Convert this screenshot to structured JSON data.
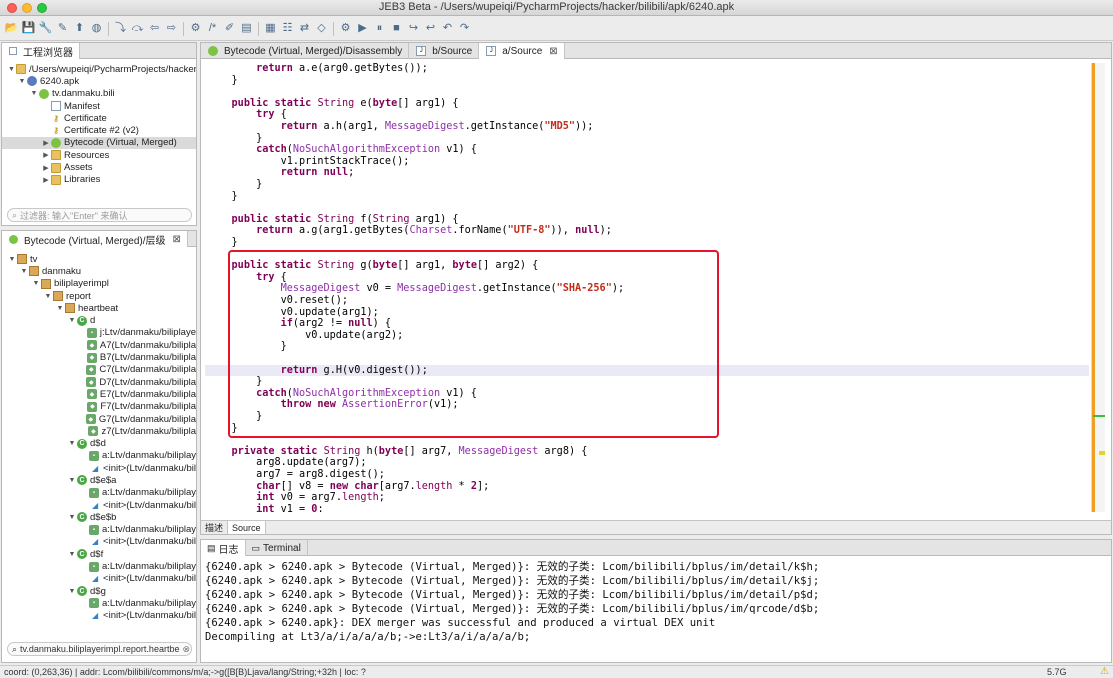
{
  "window": {
    "title": "JEB3 Beta - /Users/wupeiqi/PycharmProjects/hacker/bilibili/apk/6240.apk"
  },
  "toolbar": {
    "icons": [
      "open-folder-icon",
      "save-icon",
      "wrench-icon",
      "script-icon",
      "upload-icon",
      "globe-icon",
      "step-in-icon",
      "step-over-icon",
      "back-icon",
      "forward-icon",
      "run-script-icon",
      "comment-icon",
      "rename-icon",
      "doc-icon",
      "grid-icon",
      "hierarchy-icon",
      "xref-icon",
      "graph-icon",
      "debug-gear-icon",
      "play-icon",
      "pause-icon",
      "stop-icon",
      "step-icon",
      "step-out-icon",
      "step-back-icon",
      "step-into-icon"
    ]
  },
  "project_explorer": {
    "tab": "工程浏览器",
    "filter_placeholder": "过滤器: 输入\"Enter\" 来确认",
    "items": [
      {
        "label": "/Users/wupeiqi/PycharmProjects/hacker/b",
        "icon": "folder-icon"
      },
      {
        "label": "6240.apk",
        "icon": "apk-icon"
      },
      {
        "label": "tv.danmaku.bili",
        "icon": "android-icon"
      },
      {
        "label": "Manifest",
        "icon": "file-icon"
      },
      {
        "label": "Certificate",
        "icon": "key-icon"
      },
      {
        "label": "Certificate #2 (v2)",
        "icon": "key-icon"
      },
      {
        "label": "Bytecode (Virtual, Merged)",
        "icon": "android-icon"
      },
      {
        "label": "Resources",
        "icon": "folder-icon"
      },
      {
        "label": "Assets",
        "icon": "folder-icon"
      },
      {
        "label": "Libraries",
        "icon": "folder-icon"
      }
    ]
  },
  "hierarchy": {
    "tab": "Bytecode (Virtual, Merged)/层级",
    "filter_value": "tv.danmaku.biliplayerimpl.report.heartbe",
    "items": [
      {
        "label": "tv",
        "icon": "package-icon"
      },
      {
        "label": "danmaku",
        "icon": "package-icon"
      },
      {
        "label": "biliplayerimpl",
        "icon": "package-icon"
      },
      {
        "label": "report",
        "icon": "package-icon"
      },
      {
        "label": "heartbeat",
        "icon": "package-icon"
      },
      {
        "label": "d",
        "icon": "class-icon"
      },
      {
        "label": "j:Ltv/danmaku/biliplaye",
        "icon": "field-icon"
      },
      {
        "label": "A7(Ltv/danmaku/bilipla",
        "icon": "method-icon"
      },
      {
        "label": "B7(Ltv/danmaku/bilipla",
        "icon": "method-icon"
      },
      {
        "label": "C7(Ltv/danmaku/bilipla",
        "icon": "method-icon"
      },
      {
        "label": "D7(Ltv/danmaku/bilipla",
        "icon": "method-icon"
      },
      {
        "label": "E7(Ltv/danmaku/bilipla",
        "icon": "method-icon"
      },
      {
        "label": "F7(Ltv/danmaku/bilipla",
        "icon": "method-icon"
      },
      {
        "label": "G7(Ltv/danmaku/bilipla",
        "icon": "method-icon"
      },
      {
        "label": "z7(Ltv/danmaku/bilipla",
        "icon": "method-icon"
      },
      {
        "label": "d$d",
        "icon": "class-icon"
      },
      {
        "label": "a:Ltv/danmaku/biliplay",
        "icon": "field-icon"
      },
      {
        "label": "<init>(Ltv/danmaku/bil",
        "icon": "constructor-icon"
      },
      {
        "label": "d$e$a",
        "icon": "class-icon"
      },
      {
        "label": "a:Ltv/danmaku/biliplay",
        "icon": "field-icon"
      },
      {
        "label": "<init>(Ltv/danmaku/bil",
        "icon": "constructor-icon"
      },
      {
        "label": "d$e$b",
        "icon": "class-icon"
      },
      {
        "label": "a:Ltv/danmaku/biliplay",
        "icon": "field-icon"
      },
      {
        "label": "<init>(Ltv/danmaku/bil",
        "icon": "constructor-icon"
      },
      {
        "label": "d$f",
        "icon": "class-icon"
      },
      {
        "label": "a:Ltv/danmaku/biliplay",
        "icon": "field-icon"
      },
      {
        "label": "<init>(Ltv/danmaku/bil",
        "icon": "constructor-icon"
      },
      {
        "label": "d$g",
        "icon": "class-icon"
      },
      {
        "label": "a:Ltv/danmaku/biliplay",
        "icon": "field-icon"
      },
      {
        "label": "<init>(Ltv/danmaku/bil",
        "icon": "constructor-icon"
      }
    ]
  },
  "editor": {
    "tabs": [
      {
        "label": "Bytecode (Virtual, Merged)/Disassembly",
        "icon": "android-icon"
      },
      {
        "label": "b/Source",
        "icon": "java-file-icon"
      },
      {
        "label": "a/Source",
        "icon": "java-file-icon"
      }
    ],
    "sub_tabs": [
      "描述",
      "Source"
    ],
    "lines": [
      [
        [
          "        ",
          ""
        ],
        [
          "return",
          "kw"
        ],
        [
          " a.e(arg0.getBytes());",
          ""
        ]
      ],
      [
        [
          "    }",
          ""
        ]
      ],
      [
        [
          "",
          ""
        ]
      ],
      [
        [
          "    ",
          ""
        ],
        [
          "public",
          "kw"
        ],
        [
          " ",
          ""
        ],
        [
          "static",
          "kw"
        ],
        [
          " ",
          ""
        ],
        [
          "String",
          "ty"
        ],
        [
          " e(",
          ""
        ],
        [
          "byte",
          "kw"
        ],
        [
          "[] arg1) {",
          ""
        ]
      ],
      [
        [
          "        ",
          ""
        ],
        [
          "try",
          "kw"
        ],
        [
          " {",
          ""
        ]
      ],
      [
        [
          "            ",
          ""
        ],
        [
          "return",
          "kw"
        ],
        [
          " a.h(arg1, ",
          ""
        ],
        [
          "MessageDigest",
          "cls"
        ],
        [
          ".getInstance(",
          ""
        ],
        [
          "\"MD5\"",
          "str"
        ],
        [
          "));",
          ""
        ]
      ],
      [
        [
          "        }",
          ""
        ]
      ],
      [
        [
          "        ",
          ""
        ],
        [
          "catch",
          "kw"
        ],
        [
          "(",
          ""
        ],
        [
          "NoSuchAlgorithmException",
          "cls"
        ],
        [
          " v1) {",
          ""
        ]
      ],
      [
        [
          "            v1.printStackTrace();",
          ""
        ]
      ],
      [
        [
          "            ",
          ""
        ],
        [
          "return",
          "kw"
        ],
        [
          " ",
          ""
        ],
        [
          "null",
          "kw"
        ],
        [
          ";",
          ""
        ]
      ],
      [
        [
          "        }",
          ""
        ]
      ],
      [
        [
          "    }",
          ""
        ]
      ],
      [
        [
          "",
          ""
        ]
      ],
      [
        [
          "    ",
          ""
        ],
        [
          "public",
          "kw"
        ],
        [
          " ",
          ""
        ],
        [
          "static",
          "kw"
        ],
        [
          " ",
          ""
        ],
        [
          "String",
          "ty"
        ],
        [
          " f(",
          ""
        ],
        [
          "String",
          "ty"
        ],
        [
          " arg1) {",
          ""
        ]
      ],
      [
        [
          "        ",
          ""
        ],
        [
          "return",
          "kw"
        ],
        [
          " a.g(arg1.getBytes(",
          ""
        ],
        [
          "Charset",
          "cls"
        ],
        [
          ".forName(",
          ""
        ],
        [
          "\"UTF-8\"",
          "str"
        ],
        [
          ")), ",
          ""
        ],
        [
          "null",
          "kw"
        ],
        [
          ");",
          ""
        ]
      ],
      [
        [
          "    }",
          ""
        ]
      ],
      [
        [
          "",
          ""
        ]
      ],
      [
        [
          "    ",
          ""
        ],
        [
          "public",
          "kw"
        ],
        [
          " ",
          ""
        ],
        [
          "static",
          "kw"
        ],
        [
          " ",
          ""
        ],
        [
          "String",
          "ty"
        ],
        [
          " g(",
          ""
        ],
        [
          "byte",
          "kw"
        ],
        [
          "[] arg1, ",
          ""
        ],
        [
          "byte",
          "kw"
        ],
        [
          "[] arg2) {",
          ""
        ]
      ],
      [
        [
          "        ",
          ""
        ],
        [
          "try",
          "kw"
        ],
        [
          " {",
          ""
        ]
      ],
      [
        [
          "            ",
          ""
        ],
        [
          "MessageDigest",
          "cls"
        ],
        [
          " v0 = ",
          ""
        ],
        [
          "MessageDigest",
          "cls"
        ],
        [
          ".getInstance(",
          ""
        ],
        [
          "\"SHA-256\"",
          "str"
        ],
        [
          ");",
          ""
        ]
      ],
      [
        [
          "            v0.reset();",
          ""
        ]
      ],
      [
        [
          "            v0.update(arg1);",
          ""
        ]
      ],
      [
        [
          "            ",
          ""
        ],
        [
          "if",
          "kw"
        ],
        [
          "(arg2 != ",
          ""
        ],
        [
          "null",
          "kw"
        ],
        [
          ") {",
          ""
        ]
      ],
      [
        [
          "                v0.update(arg2);",
          ""
        ]
      ],
      [
        [
          "            }",
          ""
        ]
      ],
      [
        [
          "",
          ""
        ]
      ],
      [
        [
          "            ",
          ""
        ],
        [
          "return",
          "kw"
        ],
        [
          " g.H(v0.digest());",
          ""
        ]
      ],
      [
        [
          "        }",
          ""
        ]
      ],
      [
        [
          "        ",
          ""
        ],
        [
          "catch",
          "kw"
        ],
        [
          "(",
          ""
        ],
        [
          "NoSuchAlgorithmException",
          "cls"
        ],
        [
          " v1) {",
          ""
        ]
      ],
      [
        [
          "            ",
          ""
        ],
        [
          "throw",
          "kw"
        ],
        [
          " ",
          ""
        ],
        [
          "new",
          "kw"
        ],
        [
          " ",
          ""
        ],
        [
          "AssertionError",
          "cls"
        ],
        [
          "(v1);",
          ""
        ]
      ],
      [
        [
          "        }",
          ""
        ]
      ],
      [
        [
          "    }",
          ""
        ]
      ],
      [
        [
          "",
          ""
        ]
      ],
      [
        [
          "    ",
          ""
        ],
        [
          "private",
          "kw"
        ],
        [
          " ",
          ""
        ],
        [
          "static",
          "kw"
        ],
        [
          " ",
          ""
        ],
        [
          "String",
          "ty"
        ],
        [
          " h(",
          ""
        ],
        [
          "byte",
          "kw"
        ],
        [
          "[] arg7, ",
          ""
        ],
        [
          "MessageDigest",
          "cls"
        ],
        [
          " arg8) {",
          ""
        ]
      ],
      [
        [
          "        arg8.update(arg7);",
          ""
        ]
      ],
      [
        [
          "        arg7 = arg8.digest();",
          ""
        ]
      ],
      [
        [
          "        ",
          ""
        ],
        [
          "char",
          "kw"
        ],
        [
          "[] v8 = ",
          ""
        ],
        [
          "new",
          "kw"
        ],
        [
          " ",
          ""
        ],
        [
          "char",
          "kw"
        ],
        [
          "[arg7.",
          ""
        ],
        [
          "length",
          "ty"
        ],
        [
          " * ",
          ""
        ],
        [
          "2",
          "kw"
        ],
        [
          "];",
          ""
        ]
      ],
      [
        [
          "        ",
          ""
        ],
        [
          "int",
          "kw"
        ],
        [
          " v0 = arg7.",
          ""
        ],
        [
          "length",
          "ty"
        ],
        [
          ";",
          ""
        ]
      ],
      [
        [
          "        ",
          ""
        ],
        [
          "int",
          "kw"
        ],
        [
          " v1 = ",
          ""
        ],
        [
          "0",
          "kw"
        ],
        [
          ";",
          ""
        ]
      ]
    ]
  },
  "console": {
    "tabs": [
      "日志",
      "Terminal"
    ],
    "lines": [
      "{6240.apk > 6240.apk > Bytecode (Virtual, Merged)}: 无效的子类: Lcom/bilibili/bplus/im/detail/k$h;",
      "{6240.apk > 6240.apk > Bytecode (Virtual, Merged)}: 无效的子类: Lcom/bilibili/bplus/im/detail/k$j;",
      "{6240.apk > 6240.apk > Bytecode (Virtual, Merged)}: 无效的子类: Lcom/bilibili/bplus/im/detail/p$d;",
      "{6240.apk > 6240.apk > Bytecode (Virtual, Merged)}: 无效的子类: Lcom/bilibili/bplus/im/qrcode/d$b;",
      "{6240.apk > 6240.apk}: DEX merger was successful and produced a virtual DEX unit",
      "Decompiling at Lt3/a/i/a/a/a/b;->e:Lt3/a/i/a/a/a/b;"
    ]
  },
  "status": {
    "left": "coord: (0,263,36) | addr: Lcom/bilibili/commons/m/a;->g([B[B)Ljava/lang/String;+32h | loc: ?",
    "memory": "5.7G"
  }
}
